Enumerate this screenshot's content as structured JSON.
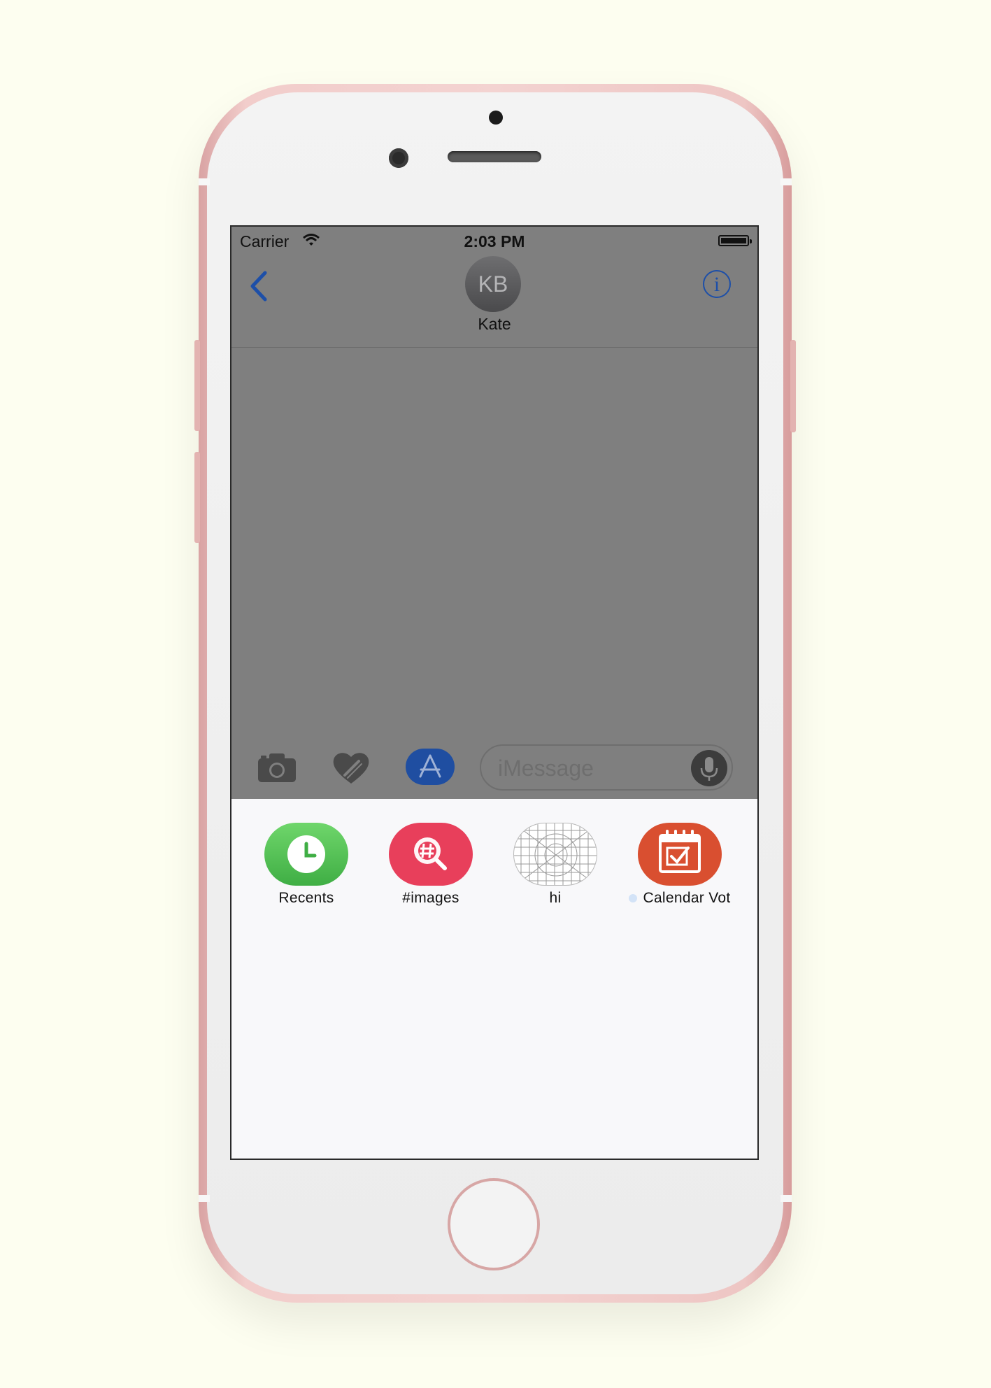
{
  "status_bar": {
    "carrier": "Carrier",
    "time": "2:03 PM"
  },
  "header": {
    "avatar_initials": "KB",
    "contact_name": "Kate",
    "info_glyph": "i"
  },
  "compose": {
    "placeholder": "iMessage"
  },
  "toolbar_icons": [
    "camera-icon",
    "digital-touch-heart-icon",
    "app-store-icon",
    "microphone-icon"
  ],
  "apps": [
    {
      "label": "Recents",
      "icon": "clock-icon",
      "color": "#4cc04f"
    },
    {
      "label": "#images",
      "icon": "image-search-icon",
      "color": "#e83f5b"
    },
    {
      "label": "hi",
      "icon": "placeholder-grid-icon",
      "color": "#ffffff"
    },
    {
      "label": "Calendar Vot",
      "icon": "calendar-check-icon",
      "color": "#d94f30"
    }
  ],
  "colors": {
    "accent": "#1d4fa8",
    "background": "#fdfef0",
    "phone_frame": "#f2cdcb",
    "overlay": "#7f7f7f"
  }
}
